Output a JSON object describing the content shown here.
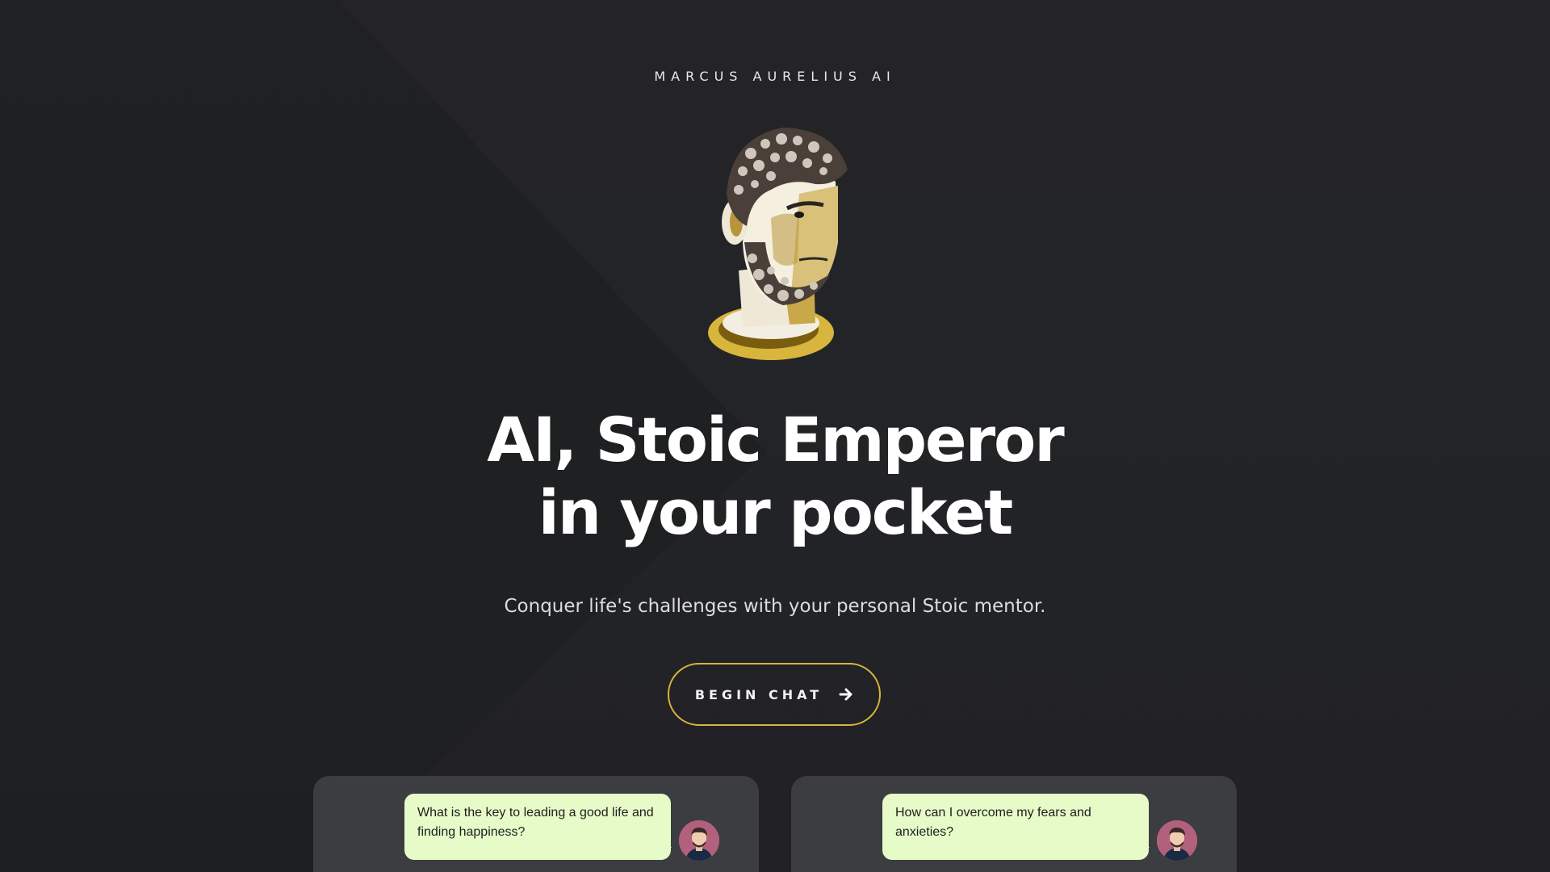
{
  "brand": {
    "title": "MARCUS AURELIUS AI"
  },
  "hero": {
    "headline_line1": "AI, Stoic Emperor",
    "headline_line2": "in your pocket",
    "subtitle": "Conquer life's challenges with your personal Stoic mentor.",
    "cta_label": "BEGIN CHAT",
    "cta_icon": "arrow-right-icon",
    "bust_image": "marcus-aurelius-bust"
  },
  "colors": {
    "background": "#222326",
    "accent_gold": "#d8b53c",
    "card_background": "#3c3d40",
    "bubble_background": "#e6fbc8",
    "avatar_background": "#b2617d"
  },
  "chat_previews": [
    {
      "question": "What is the key to leading a good life and finding happiness?",
      "avatar": "user-avatar"
    },
    {
      "question": "How can I overcome my fears and anxieties?",
      "avatar": "user-avatar"
    }
  ]
}
